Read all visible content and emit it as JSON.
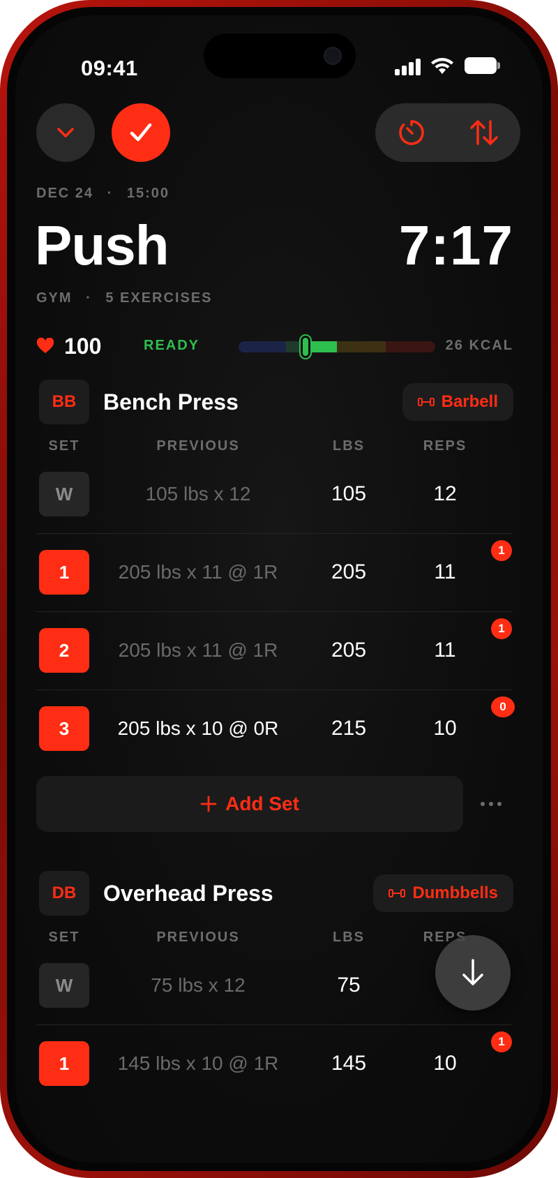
{
  "status_bar": {
    "time": "09:41"
  },
  "workout": {
    "date": "DEC 24",
    "time": "15:00",
    "title": "Push",
    "timer": "7:17",
    "location": "GYM",
    "exercise_count": "5 EXERCISES"
  },
  "heart_rate": {
    "bpm": "100",
    "zone": "READY",
    "kcal": "26 KCAL",
    "zone_position": 0.34,
    "zone_colors": [
      "#1b2447",
      "#1f3a2a",
      "#2fbf4f",
      "#3d3114",
      "#3a1612"
    ]
  },
  "columns": {
    "set": "SET",
    "previous": "PREVIOUS",
    "lbs": "LBS",
    "reps": "REPS"
  },
  "exercises": [
    {
      "abbr": "BB",
      "name": "Bench Press",
      "equipment": "Barbell",
      "equipment_icon": "dumbbell-icon",
      "sets": [
        {
          "label": "W",
          "type": "warmup",
          "previous": "105 lbs x 12",
          "lbs": "105",
          "reps": "12",
          "rir": null
        },
        {
          "label": "1",
          "type": "working",
          "previous": "205 lbs x 11 @ 1R",
          "lbs": "205",
          "reps": "11",
          "rir": "1"
        },
        {
          "label": "2",
          "type": "working",
          "previous": "205 lbs x 11 @ 1R",
          "lbs": "205",
          "reps": "11",
          "rir": "1"
        },
        {
          "label": "3",
          "type": "working",
          "previous": "205 lbs x 10 @ 0R",
          "lbs": "215",
          "reps": "10",
          "rir": "0",
          "previous_highlight": true
        }
      ],
      "add_set_label": "Add Set"
    },
    {
      "abbr": "DB",
      "name": "Overhead Press",
      "equipment": "Dumbbells",
      "equipment_icon": "dumbbell-icon",
      "sets": [
        {
          "label": "W",
          "type": "warmup",
          "previous": "75 lbs x 12",
          "lbs": "75",
          "reps": "",
          "rir": null
        },
        {
          "label": "1",
          "type": "working",
          "previous": "145 lbs x 10 @ 1R",
          "lbs": "145",
          "reps": "10",
          "rir": "1"
        }
      ]
    }
  ],
  "colors": {
    "accent": "#ff2d14",
    "zone_green": "#2fbf4f",
    "frame": "#b8140c"
  }
}
